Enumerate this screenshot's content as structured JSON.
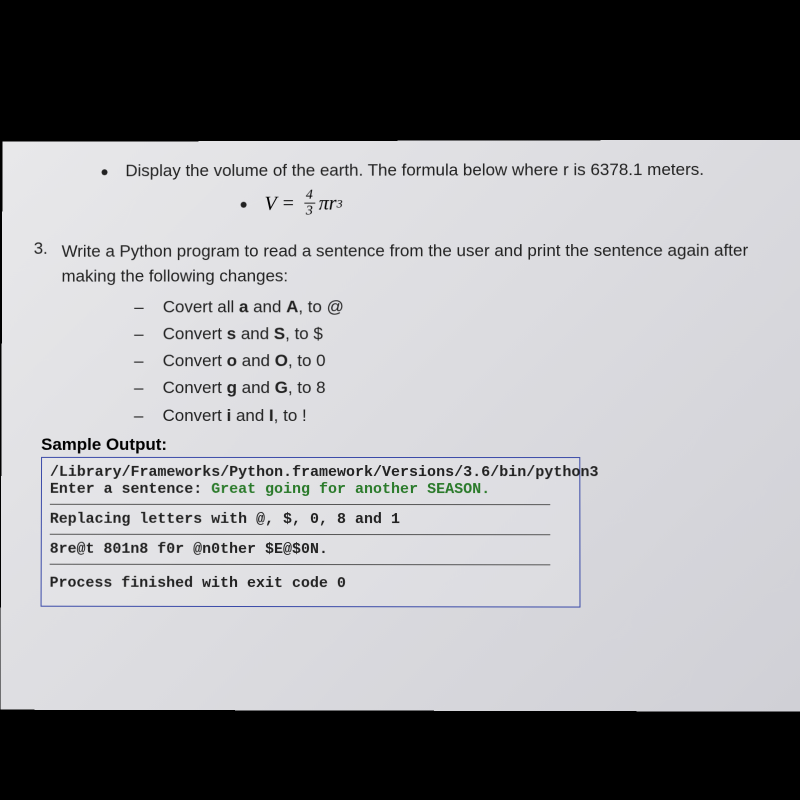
{
  "bullet_earth": "Display the volume of the earth. The formula below where r is 6378.1 meters.",
  "formula": {
    "lhs": "V",
    "eq": "=",
    "num": "4",
    "den": "3",
    "pi": "π",
    "r": "r",
    "exp": "3"
  },
  "q3": {
    "num": "3.",
    "text": "Write a Python program to read a sentence from the user and print the sentence again after making the following changes:",
    "items": [
      {
        "pre": "Covert all ",
        "b1": "a",
        "mid": " and ",
        "b2": "A",
        "post": ", to @"
      },
      {
        "pre": "Convert ",
        "b1": "s",
        "mid": " and ",
        "b2": "S",
        "post": ", to $"
      },
      {
        "pre": "Convert ",
        "b1": "o",
        "mid": " and ",
        "b2": "O",
        "post": ", to 0"
      },
      {
        "pre": "Convert ",
        "b1": "g",
        "mid": " and ",
        "b2": "G",
        "post": ", to 8"
      },
      {
        "pre": "Convert ",
        "b1": "i",
        "mid": " and ",
        "b2": "I",
        "post": ", to !"
      }
    ]
  },
  "sample_label": "Sample Output:",
  "output": {
    "path": "/Library/Frameworks/Python.framework/Versions/3.6/bin/python3",
    "prompt": "Enter a sentence: ",
    "input": "Great going for another SEASON.",
    "replacing": "Replacing letters with @, $, 0, 8 and 1",
    "result": "8re@t 801n8 f0r @n0ther $E@$0N.",
    "exit": "Process finished with exit code 0"
  }
}
